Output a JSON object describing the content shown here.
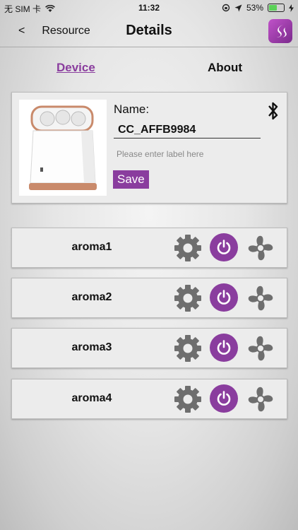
{
  "status_bar": {
    "carrier": "无 SIM 卡",
    "time": "11:32",
    "battery_percent": "53%",
    "battery_level": 0.53
  },
  "nav": {
    "back_label": "Resource",
    "back_chevron": "<",
    "title": "Details",
    "logo_icon": "brand-logo-icon"
  },
  "tabs": {
    "device": "Device",
    "about": "About"
  },
  "device": {
    "name_label": "Name:",
    "name_value": "CC_AFFB9984",
    "label_placeholder": "Please enter label here",
    "save_label": "Save",
    "bluetooth_icon": "bluetooth-icon"
  },
  "aromas": [
    {
      "label": "aroma1"
    },
    {
      "label": "aroma2"
    },
    {
      "label": "aroma3"
    },
    {
      "label": "aroma4"
    }
  ],
  "colors": {
    "accent": "#8a3d9e",
    "icon_gray": "#6e6e6e"
  }
}
